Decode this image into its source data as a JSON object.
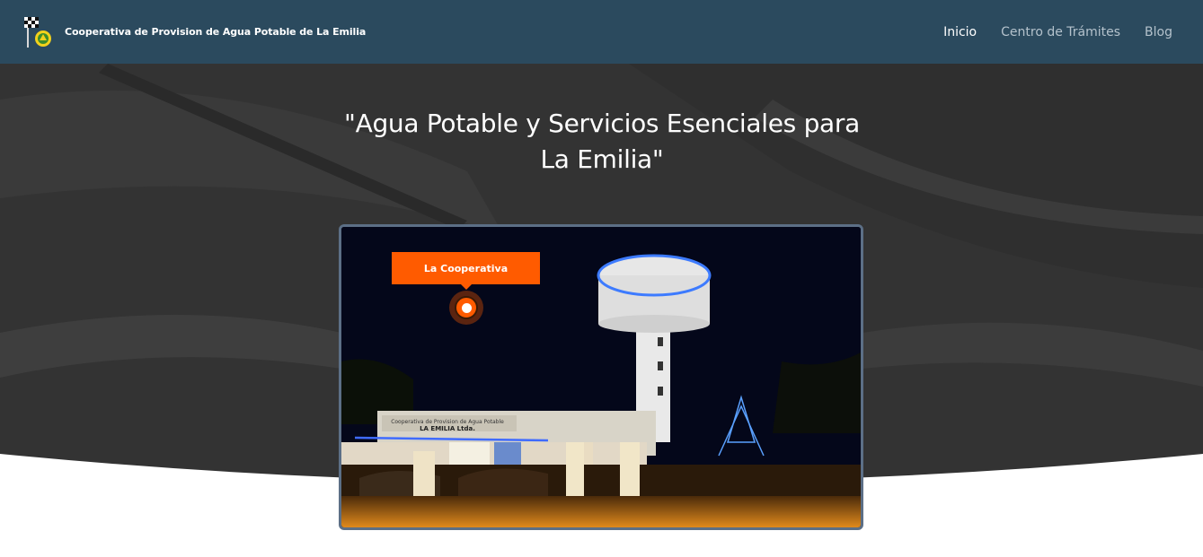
{
  "header": {
    "brand_name": "Cooperativa de Provision de Agua Potable de La Emilia",
    "logo_icon": "checkered-flag-logo-icon",
    "nav": [
      {
        "label": "Inicio",
        "active": true
      },
      {
        "label": "Centro de Trámites",
        "active": false
      },
      {
        "label": "Blog",
        "active": false
      }
    ]
  },
  "hero": {
    "title": "\"Agua Potable y Servicios Esenciales para La Emilia\"",
    "feature": {
      "image_icon": "water-tower-photo",
      "hotspot_label": "La Cooperativa",
      "hotspot_icon": "location-dot-icon",
      "building_sign_line1": "Cooperativa de Provision de Agua Potable",
      "building_sign_line2": "LA EMILIA Ltda."
    }
  },
  "colors": {
    "navbar": "#2b4a5e",
    "hero_bg": "#333333",
    "accent": "#ff5b00",
    "frame_border": "#5c6f86"
  }
}
